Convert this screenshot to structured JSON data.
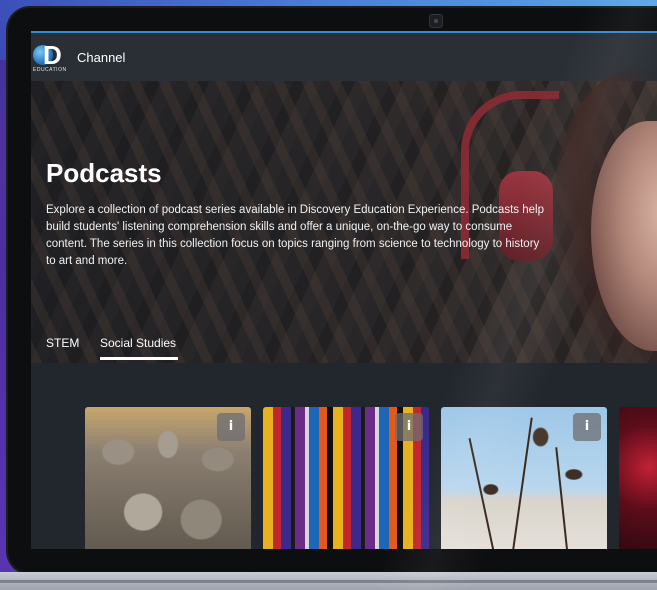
{
  "header": {
    "logo_letter": "D",
    "logo_sub": "EDUCATION",
    "channel_label": "Channel"
  },
  "hero": {
    "title": "Podcasts",
    "description": "Explore a collection of podcast series available in Discovery Education Experience. Podcasts help build students' listening comprehension skills and offer a unique, on-the-go way to consume content. The series in this collection focus on topics ranging from science to technology to history to art and more."
  },
  "tabs": [
    {
      "label": "STEM",
      "selected": false
    },
    {
      "label": "Social Studies",
      "selected": true
    }
  ],
  "cards": [
    {
      "image": "terracotta-army",
      "info_icon": "i"
    },
    {
      "image": "book-spines-ally",
      "info_icon": "i"
    },
    {
      "image": "cotton-plant-field",
      "info_icon": "i"
    },
    {
      "image": "red-neon-partial"
    }
  ],
  "colors": {
    "accent_blue": "#2f8cd6",
    "screen_bg": "#22262d",
    "topbar_bg": "#2a2e35"
  }
}
